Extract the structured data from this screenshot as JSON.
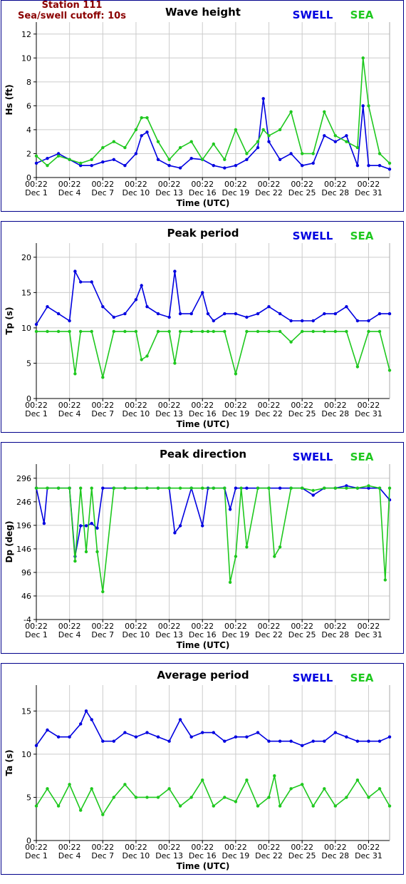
{
  "header": {
    "station": "Station 111",
    "cutoff": "Sea/swell cutoff: 10s"
  },
  "legend": {
    "swell": "SWELL",
    "sea": "SEA"
  },
  "colors": {
    "swell": "#0000e0",
    "sea": "#1ec81e",
    "border": "#00008b",
    "station": "#8b0000",
    "grid": "#cccccc"
  },
  "chart_data": [
    {
      "type": "line",
      "title": "Wave height",
      "ylabel": "Hs (ft)",
      "xlabel": "Time (UTC)",
      "ylim": [
        0,
        13
      ],
      "yticks": [
        0,
        2,
        4,
        6,
        8,
        10,
        12
      ],
      "xlim": [
        0,
        31.9
      ],
      "xtick_positions": [
        0,
        3,
        6,
        9,
        12,
        15,
        18,
        21,
        24,
        27,
        30
      ],
      "xtick_top": [
        "00:22",
        "00:22",
        "00:22",
        "00:22",
        "00:22",
        "00:22",
        "00:22",
        "00:22",
        "00:22",
        "00:22",
        "00:22"
      ],
      "xtick_bottom": [
        "Dec 1",
        "Dec 4",
        "Dec 7",
        "Dec 10",
        "Dec 13",
        "Dec 16",
        "Dec 19",
        "Dec 22",
        "Dec 25",
        "Dec 28",
        "Dec 31"
      ],
      "grid": true,
      "series": [
        {
          "name": "SWELL",
          "x": [
            0,
            1,
            2,
            3,
            4,
            5,
            6,
            7,
            8,
            9,
            9.5,
            10,
            11,
            12,
            13,
            14,
            15,
            16,
            17,
            18,
            19,
            20,
            20.5,
            21,
            22,
            23,
            24,
            25,
            26,
            27,
            28,
            29,
            29.5,
            30,
            31,
            31.9
          ],
          "values": [
            1.2,
            1.6,
            2.0,
            1.5,
            1.0,
            1.0,
            1.3,
            1.5,
            1.0,
            2.0,
            3.5,
            3.8,
            1.5,
            1.0,
            0.8,
            1.6,
            1.5,
            1.0,
            0.8,
            1.0,
            1.5,
            2.5,
            6.6,
            3.0,
            1.5,
            2.0,
            1.0,
            1.2,
            3.5,
            3.0,
            3.5,
            1.0,
            6.0,
            1.0,
            1.0,
            0.7
          ]
        },
        {
          "name": "SEA",
          "x": [
            0,
            1,
            2,
            3,
            4,
            5,
            6,
            7,
            8,
            9,
            9.5,
            10,
            11,
            12,
            13,
            14,
            15,
            16,
            17,
            18,
            19,
            20,
            20.5,
            21,
            22,
            23,
            24,
            25,
            26,
            27,
            28,
            29,
            29.5,
            30,
            31,
            31.9
          ],
          "values": [
            1.8,
            1.0,
            1.8,
            1.5,
            1.2,
            1.5,
            2.5,
            3.0,
            2.5,
            4.0,
            5.0,
            5.0,
            3.0,
            1.5,
            2.5,
            3.0,
            1.5,
            2.8,
            1.5,
            4.0,
            2.0,
            3.0,
            4.0,
            3.5,
            4.0,
            5.5,
            2.0,
            2.0,
            5.5,
            3.5,
            3.0,
            2.5,
            10.0,
            6.0,
            2.0,
            1.2
          ]
        }
      ]
    },
    {
      "type": "scatter",
      "title": "Peak period",
      "ylabel": "Tp (s)",
      "xlabel": "Time (UTC)",
      "ylim": [
        0,
        22
      ],
      "yticks": [
        0,
        5,
        10,
        15,
        20
      ],
      "xlim": [
        0,
        31.9
      ],
      "xtick_positions": [
        0,
        3,
        6,
        9,
        12,
        15,
        18,
        21,
        24,
        27,
        30
      ],
      "xtick_top": [
        "00:22",
        "00:22",
        "00:22",
        "00:22",
        "00:22",
        "00:22",
        "00:22",
        "00:22",
        "00:22",
        "00:22",
        "00:22"
      ],
      "xtick_bottom": [
        "Dec 1",
        "Dec 4",
        "Dec 7",
        "Dec 10",
        "Dec 13",
        "Dec 16",
        "Dec 19",
        "Dec 22",
        "Dec 25",
        "Dec 28",
        "Dec 31"
      ],
      "grid": true,
      "series": [
        {
          "name": "SWELL",
          "x": [
            0,
            1,
            2,
            3,
            3.5,
            4,
            5,
            6,
            7,
            8,
            9,
            9.5,
            10,
            11,
            12,
            12.5,
            13,
            14,
            15,
            15.5,
            16,
            17,
            18,
            19,
            20,
            21,
            22,
            23,
            24,
            25,
            26,
            27,
            28,
            29,
            30,
            31,
            31.9
          ],
          "values": [
            10.5,
            13,
            12,
            11,
            18,
            16.5,
            16.5,
            13,
            11.5,
            12,
            14,
            16,
            13,
            12,
            11.5,
            18,
            12,
            12,
            15,
            12,
            11,
            12,
            12,
            11.5,
            12,
            13,
            12,
            11,
            11,
            11,
            12,
            12,
            13,
            11,
            11,
            12,
            12
          ]
        },
        {
          "name": "SEA",
          "x": [
            0,
            1,
            2,
            3,
            3.5,
            4,
            5,
            6,
            7,
            8,
            9,
            9.5,
            10,
            11,
            12,
            12.5,
            13,
            14,
            15,
            15.5,
            16,
            17,
            18,
            19,
            20,
            21,
            22,
            23,
            24,
            25,
            26,
            27,
            28,
            29,
            30,
            31,
            31.9
          ],
          "values": [
            9.5,
            9.5,
            9.5,
            9.5,
            3.5,
            9.5,
            9.5,
            3,
            9.5,
            9.5,
            9.5,
            5.5,
            6,
            9.5,
            9.5,
            5,
            9.5,
            9.5,
            9.5,
            9.5,
            9.5,
            9.5,
            3.5,
            9.5,
            9.5,
            9.5,
            9.5,
            8,
            9.5,
            9.5,
            9.5,
            9.5,
            9.5,
            4.5,
            9.5,
            9.5,
            4
          ]
        }
      ]
    },
    {
      "type": "scatter",
      "title": "Peak direction",
      "ylabel": "Dp (deg)",
      "xlabel": "Time (UTC)",
      "ylim": [
        -4,
        326
      ],
      "yticks": [
        -4,
        46,
        96,
        146,
        196,
        246,
        296
      ],
      "xlim": [
        0,
        31.9
      ],
      "xtick_positions": [
        0,
        3,
        6,
        9,
        12,
        15,
        18,
        21,
        24,
        27,
        30
      ],
      "xtick_top": [
        "00:22",
        "00:22",
        "00:22",
        "00:22",
        "00:22",
        "00:22",
        "00:22",
        "00:22",
        "00:22",
        "00:22",
        "00:22"
      ],
      "xtick_bottom": [
        "Dec 1",
        "Dec 4",
        "Dec 7",
        "Dec 10",
        "Dec 13",
        "Dec 16",
        "Dec 19",
        "Dec 22",
        "Dec 25",
        "Dec 28",
        "Dec 31"
      ],
      "grid": true,
      "series": [
        {
          "name": "SWELL",
          "x": [
            0,
            0.7,
            1,
            2,
            3,
            3.5,
            4,
            4.5,
            5,
            5.5,
            6,
            7,
            8,
            9,
            10,
            11,
            12,
            12.5,
            13,
            14,
            15,
            15.5,
            16,
            17,
            17.5,
            18,
            19,
            20,
            21,
            22,
            23,
            24,
            25,
            26,
            27,
            28,
            29,
            30,
            31,
            31.9
          ],
          "values": [
            275,
            200,
            275,
            275,
            275,
            130,
            195,
            195,
            200,
            190,
            275,
            275,
            275,
            275,
            275,
            275,
            275,
            180,
            195,
            275,
            195,
            275,
            275,
            275,
            230,
            275,
            275,
            275,
            275,
            275,
            275,
            275,
            260,
            275,
            275,
            280,
            275,
            275,
            275,
            250
          ]
        },
        {
          "name": "SEA",
          "x": [
            0,
            1,
            2,
            3,
            3.5,
            4,
            4.5,
            5,
            5.5,
            6,
            7,
            8,
            9,
            10,
            11,
            12,
            13,
            14,
            15,
            16,
            17,
            17.5,
            18,
            18.5,
            19,
            20,
            21,
            21.5,
            22,
            23,
            24,
            25,
            26,
            27,
            28,
            29,
            30,
            31,
            31.5,
            31.9
          ],
          "values": [
            275,
            275,
            275,
            275,
            120,
            275,
            140,
            275,
            140,
            55,
            275,
            275,
            275,
            275,
            275,
            275,
            275,
            275,
            275,
            275,
            275,
            75,
            130,
            275,
            150,
            275,
            275,
            130,
            150,
            275,
            275,
            270,
            275,
            275,
            275,
            275,
            280,
            275,
            80,
            275
          ]
        }
      ]
    },
    {
      "type": "scatter",
      "title": "Average period",
      "ylabel": "Ta (s)",
      "xlabel": "Time (UTC)",
      "ylim": [
        0,
        18
      ],
      "yticks": [
        0,
        5,
        10,
        15
      ],
      "xlim": [
        0,
        31.9
      ],
      "xtick_positions": [
        0,
        3,
        6,
        9,
        12,
        15,
        18,
        21,
        24,
        27,
        30
      ],
      "xtick_top": [
        "00:22",
        "00:22",
        "00:22",
        "00:22",
        "00:22",
        "00:22",
        "00:22",
        "00:22",
        "00:22",
        "00:22",
        "00:22"
      ],
      "xtick_bottom": [
        "Dec 1",
        "Dec 4",
        "Dec 7",
        "Dec 10",
        "Dec 13",
        "Dec 16",
        "Dec 19",
        "Dec 22",
        "Dec 25",
        "Dec 28",
        "Dec 31"
      ],
      "grid": true,
      "series": [
        {
          "name": "SWELL",
          "x": [
            0,
            1,
            2,
            3,
            4,
            4.5,
            5,
            6,
            7,
            8,
            9,
            10,
            11,
            12,
            13,
            14,
            15,
            16,
            17,
            18,
            19,
            20,
            21,
            22,
            23,
            24,
            25,
            26,
            27,
            28,
            29,
            30,
            31,
            31.9
          ],
          "values": [
            11,
            12.8,
            12,
            12,
            13.5,
            15,
            14,
            11.5,
            11.5,
            12.5,
            12,
            12.5,
            12,
            11.5,
            14,
            12,
            12.5,
            12.5,
            11.5,
            12,
            12,
            12.5,
            11.5,
            11.5,
            11.5,
            11,
            11.5,
            11.5,
            12.5,
            12,
            11.5,
            11.5,
            11.5,
            12
          ]
        },
        {
          "name": "SEA",
          "x": [
            0,
            1,
            2,
            3,
            4,
            5,
            6,
            7,
            8,
            9,
            10,
            11,
            12,
            13,
            14,
            15,
            16,
            17,
            18,
            19,
            20,
            21,
            21.5,
            22,
            23,
            24,
            25,
            26,
            27,
            28,
            29,
            30,
            31,
            31.9
          ],
          "values": [
            4,
            6,
            4,
            6.5,
            3.5,
            6,
            3,
            5,
            6.5,
            5,
            5,
            5,
            6,
            4,
            5,
            7,
            4,
            5,
            4.5,
            7,
            4,
            5,
            7.5,
            4,
            6,
            6.5,
            4,
            6,
            4,
            5,
            7,
            5,
            6,
            4
          ]
        }
      ]
    }
  ]
}
